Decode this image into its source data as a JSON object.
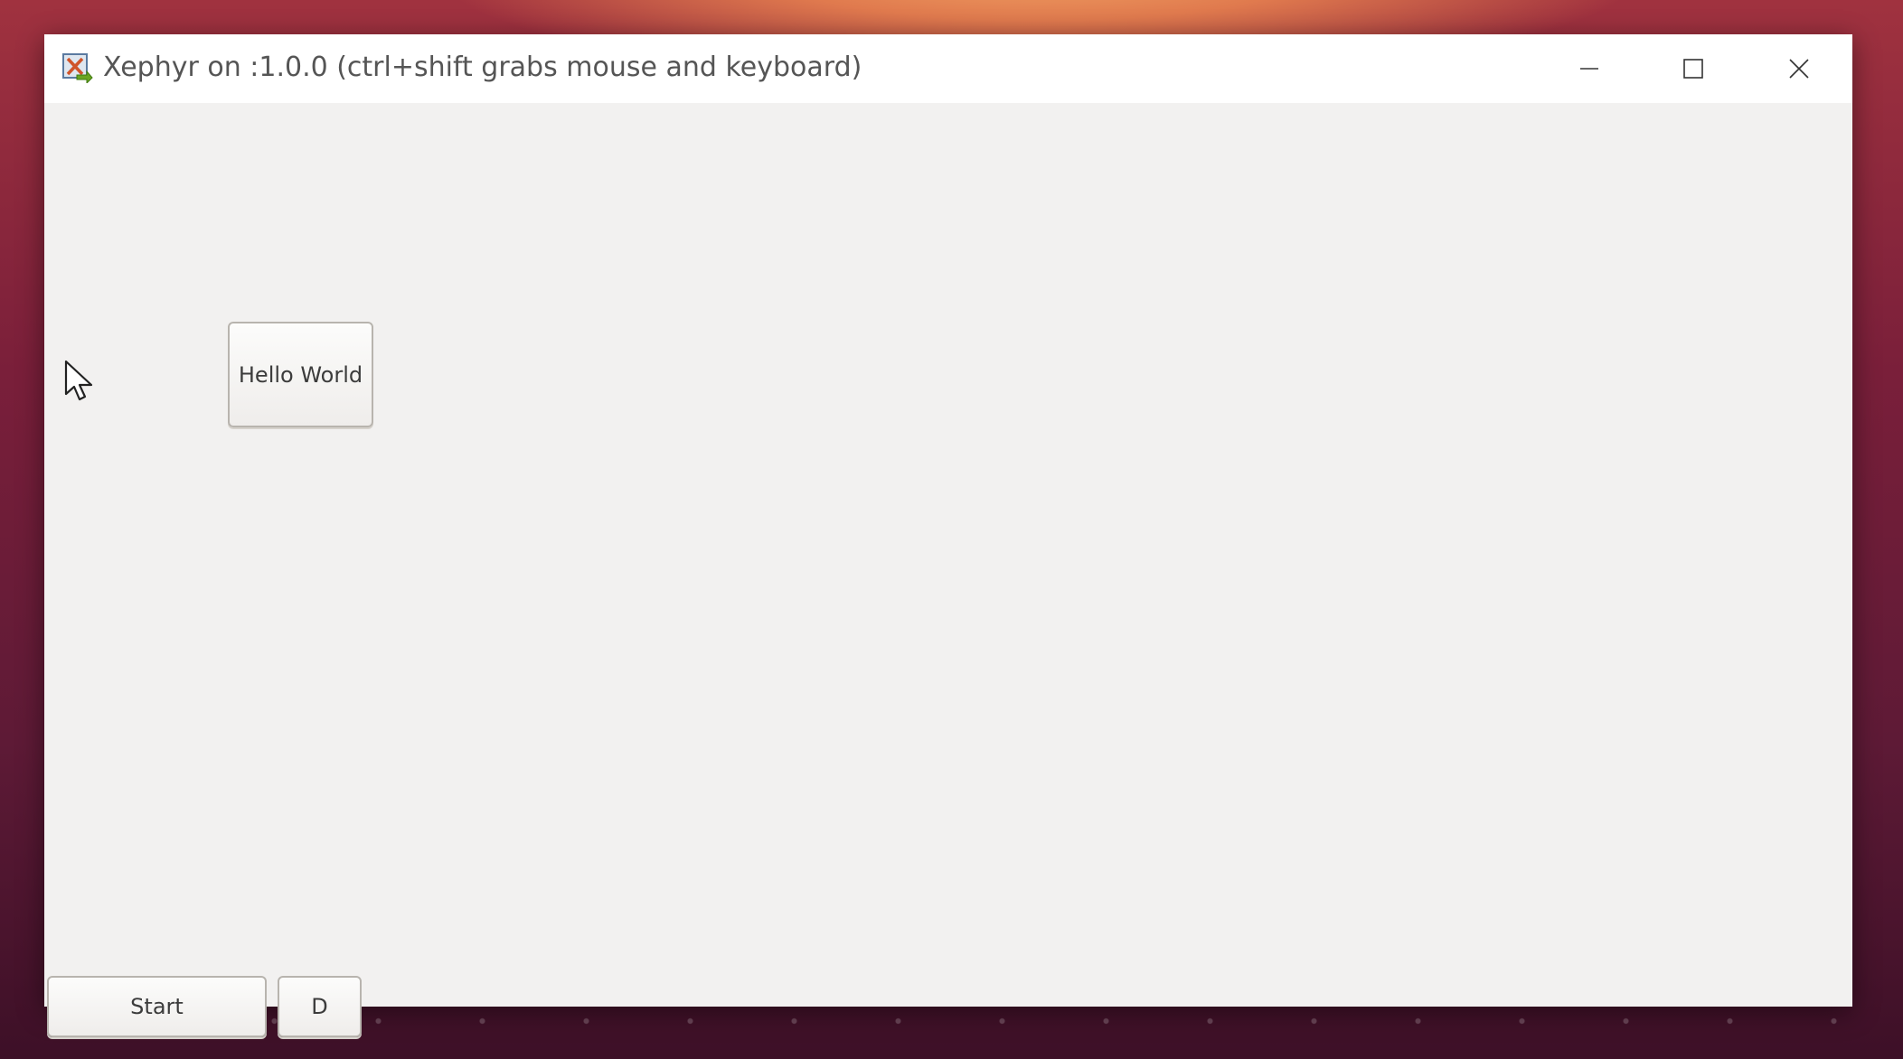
{
  "window": {
    "title": "Xephyr on :1.0.0 (ctrl+shift grabs mouse and keyboard)",
    "app_icon": "xephyr-app-icon",
    "controls": {
      "minimize_icon": "minimize-icon",
      "maximize_icon": "maximize-icon",
      "close_icon": "close-icon"
    }
  },
  "content": {
    "hello_button_label": "Hello World",
    "taskbar": {
      "start_label": "Start",
      "d_label": "D"
    }
  },
  "colors": {
    "window_bg": "#f2f1f0",
    "titlebar_bg": "#ffffff",
    "title_text": "#555555"
  }
}
